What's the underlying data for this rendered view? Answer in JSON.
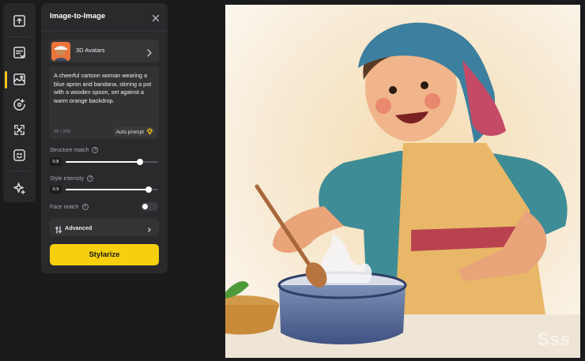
{
  "rail": {
    "tools": [
      {
        "name": "upload-image-icon"
      },
      {
        "name": "text-to-image-icon"
      },
      {
        "name": "image-to-image-icon",
        "active": true
      },
      {
        "name": "retouch-icon"
      },
      {
        "name": "upscale-icon"
      },
      {
        "name": "face-icon"
      },
      {
        "name": "sparkle-icon"
      }
    ]
  },
  "panel": {
    "title": "Image-to-Image",
    "style": {
      "name": "3D Avatars"
    },
    "prompt": {
      "text": "A cheerful cartoon woman wearing a blue apron and bandana, stirring a pot with a wooden spoon, set against a warm orange backdrop.",
      "count": "25 / 200",
      "auto_prompt_label": "Auto prompt"
    },
    "structure_match": {
      "label": "Structure match",
      "value": "0.8",
      "level": 0.8
    },
    "style_intensity": {
      "label": "Style intensity",
      "value": "0.9",
      "level": 0.9
    },
    "face_match": {
      "label": "Face match",
      "on": false
    },
    "advanced_label": "Advanced",
    "action_label": "Stylarize"
  },
  "canvas": {
    "watermark": "Sss"
  },
  "colors": {
    "accent": "#f6cf0f",
    "panel_bg": "#2a2a2d",
    "page_bg": "#1b1b1d"
  }
}
